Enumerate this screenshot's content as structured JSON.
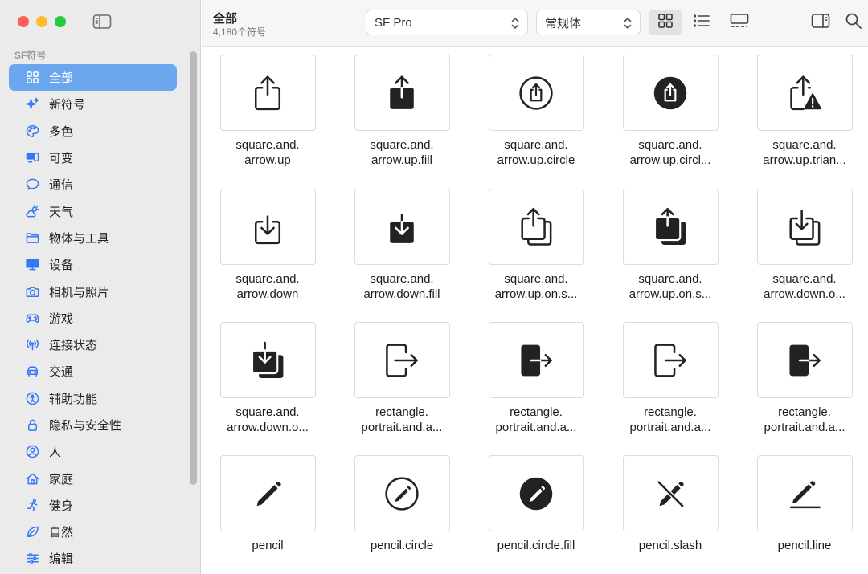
{
  "sidebar": {
    "section_title": "SF符号",
    "items": [
      {
        "label": "全部",
        "icon": "grid-icon"
      },
      {
        "label": "新符号",
        "icon": "sparkles-icon"
      },
      {
        "label": "多色",
        "icon": "paintpalette-icon"
      },
      {
        "label": "可变",
        "icon": "variable-icon"
      },
      {
        "label": "通信",
        "icon": "message-icon"
      },
      {
        "label": "天气",
        "icon": "cloud-sun-icon"
      },
      {
        "label": "物体与工具",
        "icon": "folder-icon"
      },
      {
        "label": "设备",
        "icon": "display-icon"
      },
      {
        "label": "相机与照片",
        "icon": "camera-icon"
      },
      {
        "label": "游戏",
        "icon": "gamecontroller-icon"
      },
      {
        "label": "连接状态",
        "icon": "antenna-icon"
      },
      {
        "label": "交通",
        "icon": "car-icon"
      },
      {
        "label": "辅助功能",
        "icon": "accessibility-icon"
      },
      {
        "label": "隐私与安全性",
        "icon": "lock-icon"
      },
      {
        "label": "人",
        "icon": "person-circle-icon"
      },
      {
        "label": "家庭",
        "icon": "house-icon"
      },
      {
        "label": "健身",
        "icon": "figure-run-icon"
      },
      {
        "label": "自然",
        "icon": "leaf-icon"
      },
      {
        "label": "编辑",
        "icon": "sliders-icon"
      }
    ]
  },
  "toolbar": {
    "title": "全部",
    "subtitle": "4,180个符号",
    "font_select": "SF Pro",
    "weight_select": "常规体"
  },
  "symbols": [
    {
      "name": "square.and.\narrow.up",
      "icon": "square-and-arrow-up-icon"
    },
    {
      "name": "square.and.\narrow.up.fill",
      "icon": "square-and-arrow-up-fill-icon"
    },
    {
      "name": "square.and.\narrow.up.circle",
      "icon": "square-and-arrow-up-circle-icon"
    },
    {
      "name": "square.and.\narrow.up.circl...",
      "icon": "square-and-arrow-up-circle-fill-icon"
    },
    {
      "name": "square.and.\narrow.up.trian...",
      "icon": "square-and-arrow-up-trianglebadge-icon"
    },
    {
      "name": "square.and.\narrow.down",
      "icon": "square-and-arrow-down-icon"
    },
    {
      "name": "square.and.\narrow.down.fill",
      "icon": "square-and-arrow-down-fill-icon"
    },
    {
      "name": "square.and.\narrow.up.on.s...",
      "icon": "square-and-arrow-up-on-square-icon"
    },
    {
      "name": "square.and.\narrow.up.on.s...",
      "icon": "square-and-arrow-up-on-square-fill-icon"
    },
    {
      "name": "square.and.\narrow.down.o...",
      "icon": "square-and-arrow-down-on-square-icon"
    },
    {
      "name": "square.and.\narrow.down.o...",
      "icon": "square-and-arrow-down-on-square-fill-icon"
    },
    {
      "name": "rectangle.\nportrait.and.a...",
      "icon": "rectangle-portrait-and-arrow-right-icon"
    },
    {
      "name": "rectangle.\nportrait.and.a...",
      "icon": "rectangle-portrait-and-arrow-right-fill-icon"
    },
    {
      "name": "rectangle.\nportrait.and.a...",
      "icon": "rectangle-portrait-and-arrow-forward-icon"
    },
    {
      "name": "rectangle.\nportrait.and.a...",
      "icon": "rectangle-portrait-and-arrow-forward-fill-icon"
    },
    {
      "name": "pencil",
      "icon": "pencil-icon"
    },
    {
      "name": "pencil.circle",
      "icon": "pencil-circle-icon"
    },
    {
      "name": "pencil.circle.fill",
      "icon": "pencil-circle-fill-icon"
    },
    {
      "name": "pencil.slash",
      "icon": "pencil-slash-icon"
    },
    {
      "name": "pencil.line",
      "icon": "pencil-line-icon"
    }
  ]
}
